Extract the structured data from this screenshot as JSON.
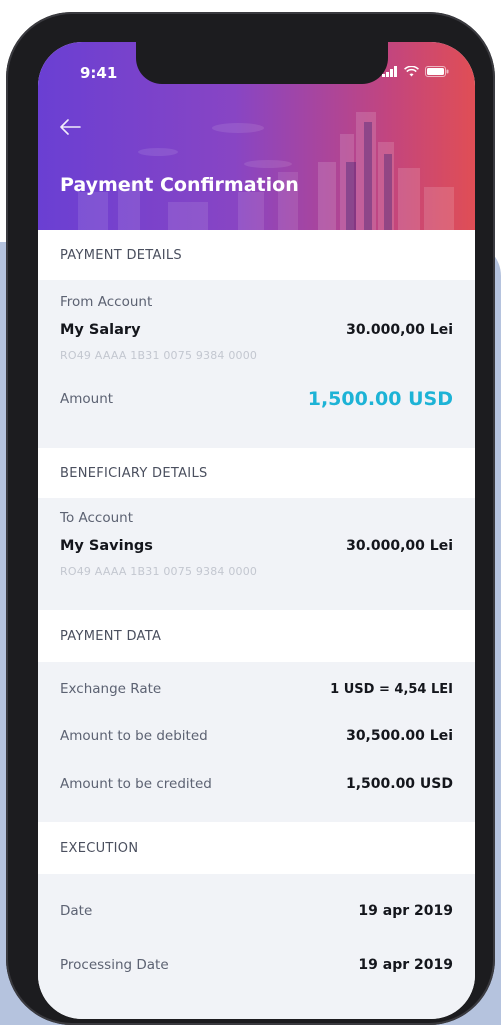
{
  "status_bar": {
    "time": "9:41"
  },
  "header": {
    "title": "Payment Confirmation"
  },
  "payment_details": {
    "heading": "PAYMENT DETAILS",
    "from_label": "From Account",
    "account_name": "My Salary",
    "account_balance": "30.000,00 Lei",
    "iban": "RO49 AAAA 1B31 0075 9384 0000",
    "amount_label": "Amount",
    "amount_value": "1,500.00 USD"
  },
  "beneficiary_details": {
    "heading": "BENEFICIARY DETAILS",
    "to_label": "To Account",
    "account_name": "My Savings",
    "account_balance": "30.000,00 Lei",
    "iban": "RO49 AAAA 1B31 0075 9384 0000"
  },
  "payment_data": {
    "heading": "PAYMENT DATA",
    "rows": [
      {
        "label": "Exchange Rate",
        "value": "1 USD = 4,54 LEI"
      },
      {
        "label": "Amount to be debited",
        "value": "30,500.00 Lei"
      },
      {
        "label": "Amount to be credited",
        "value": "1,500.00 USD"
      }
    ]
  },
  "execution": {
    "heading": "EXECUTION",
    "rows": [
      {
        "label": "Date",
        "value": "19 apr 2019"
      },
      {
        "label": "Processing Date",
        "value": "19 apr 2019"
      }
    ]
  },
  "colors": {
    "accent": "#1db3d6",
    "header_gradient_start": "#6a3fd3",
    "header_gradient_end": "#e04e55",
    "section_background": "#f1f3f7"
  },
  "icons": [
    "back-arrow-icon",
    "signal-icon",
    "wifi-icon",
    "battery-icon"
  ]
}
